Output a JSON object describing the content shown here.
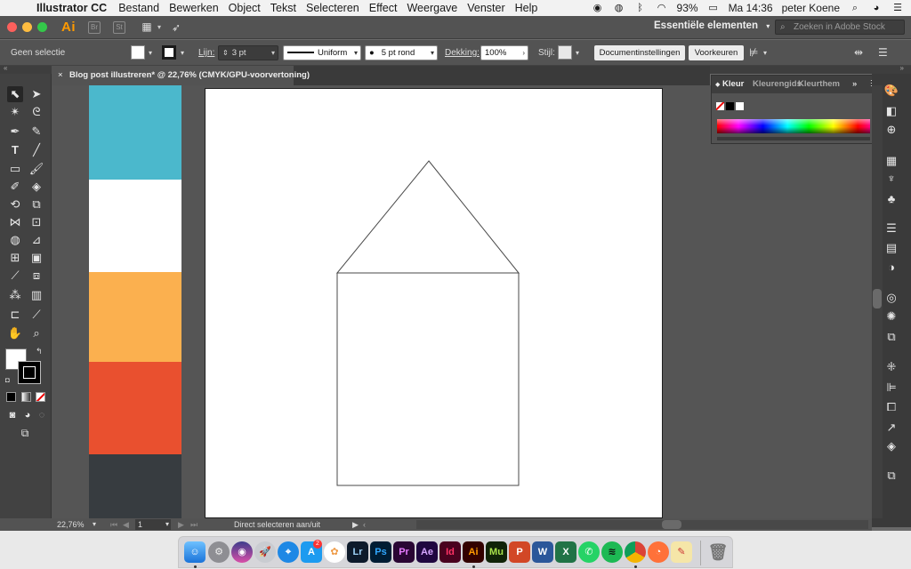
{
  "menubar": {
    "app_name": "Illustrator CC",
    "items": [
      "Bestand",
      "Bewerken",
      "Object",
      "Tekst",
      "Selecteren",
      "Effect",
      "Weergave",
      "Venster",
      "Help"
    ],
    "battery": "93%",
    "clock": "Ma 14:36",
    "user": "peter Koene"
  },
  "appbar": {
    "logo": "Ai",
    "workspace": "Essentiële elementen",
    "search_placeholder": "Zoeken in Adobe Stock"
  },
  "control": {
    "selection": "Geen selectie",
    "stroke_label": "Lijn:",
    "stroke_weight": "3 pt",
    "profile": "Uniform",
    "brush": "5 pt rond",
    "opacity_label": "Dekking:",
    "opacity": "100%",
    "style_label": "Stijl:",
    "doc_settings": "Documentinstellingen",
    "prefs": "Voorkeuren"
  },
  "document": {
    "tab": "Blog post illustreren* @ 22,76% (CMYK/GPU-voorvertoning)"
  },
  "color_panel": {
    "tabs": [
      "Kleur",
      "Kleurengids",
      "Kleurthem"
    ]
  },
  "status": {
    "zoom": "22,76%",
    "artboard": "1",
    "hint": "Direct selecteren aan/uit"
  },
  "colors": {
    "stripes": [
      "#4bb8cc",
      "#ffffff",
      "#fbb04f",
      "#e9502f",
      "#373c40"
    ],
    "accent": "#ff9a00"
  }
}
